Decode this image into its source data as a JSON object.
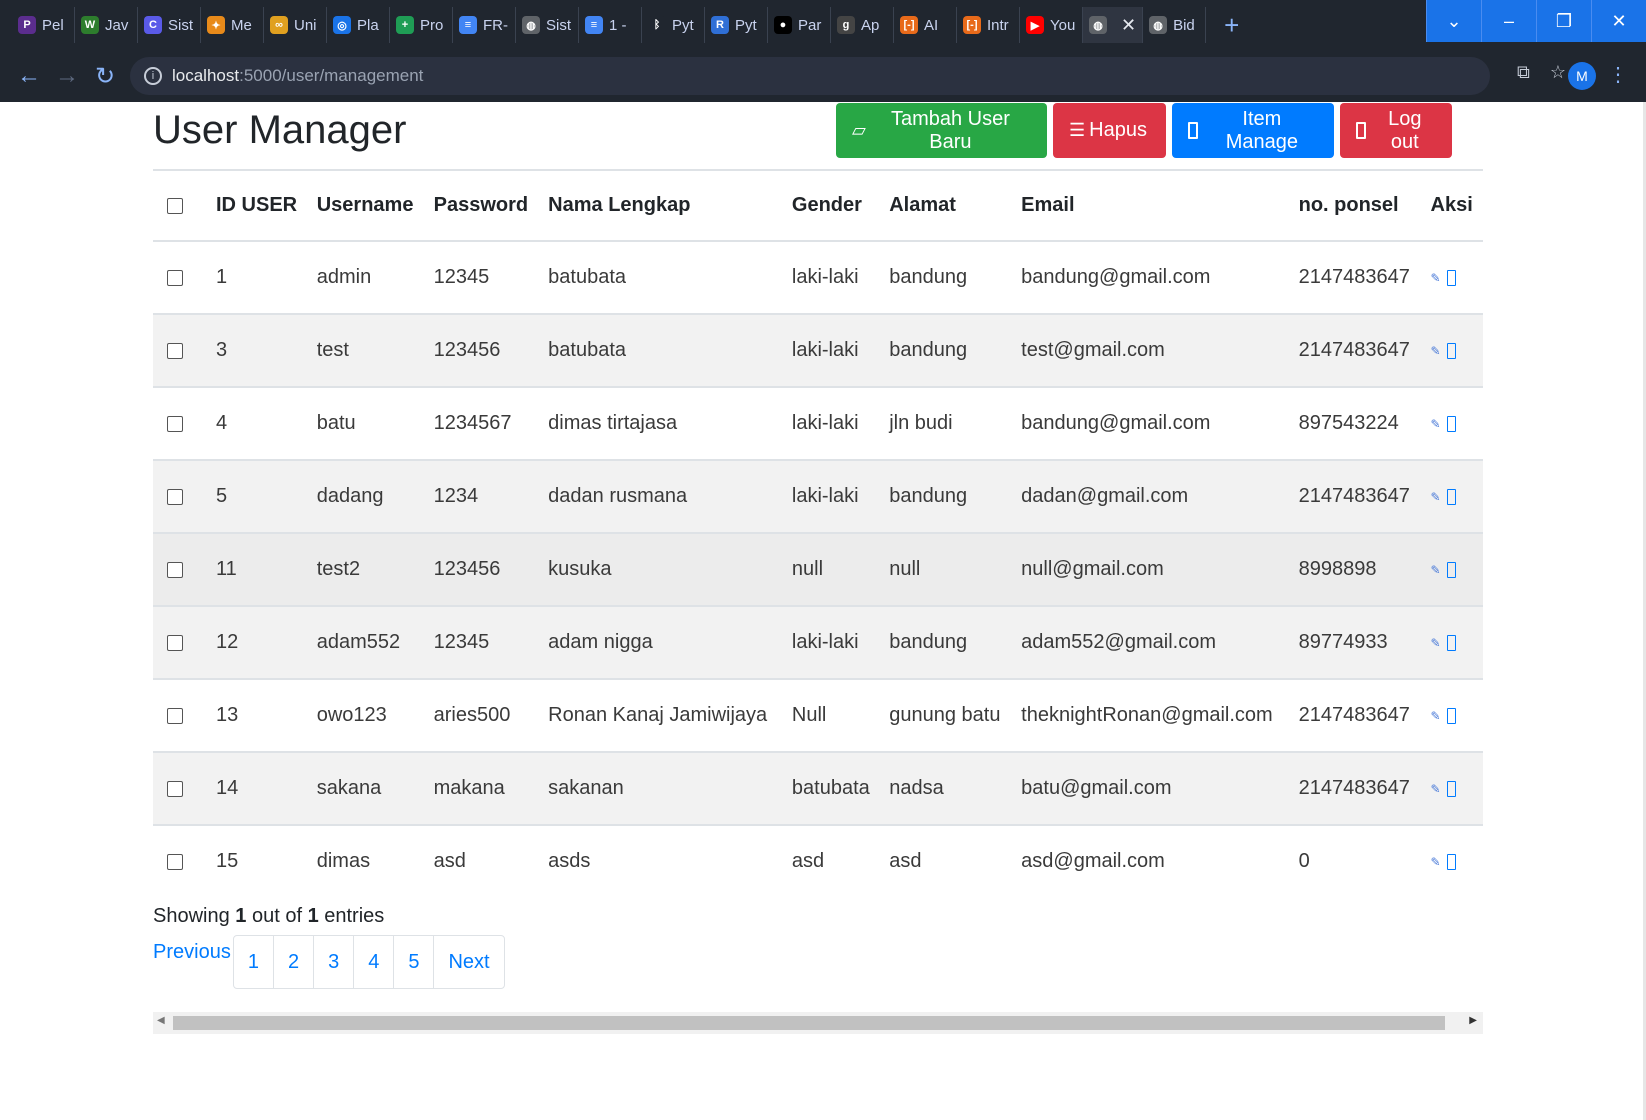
{
  "browser": {
    "tabs": [
      {
        "label": "Pel",
        "icon": "purple-p-icon",
        "color": "#5b2d8e",
        "glyph": "P"
      },
      {
        "label": "Jav",
        "icon": "w-logo-icon",
        "color": "#2d7d2d",
        "glyph": "W"
      },
      {
        "label": "Sist",
        "icon": "c-logo-icon",
        "color": "#5a5ae8",
        "glyph": "C"
      },
      {
        "label": "Me",
        "icon": "pinwheel-icon",
        "color": "#e88a1a",
        "glyph": "✦"
      },
      {
        "label": "Uni",
        "icon": "infinity-icon",
        "color": "#e0a020",
        "glyph": "∞"
      },
      {
        "label": "Pla",
        "icon": "target-icon",
        "color": "#1a73e8",
        "glyph": "◎"
      },
      {
        "label": "Pro",
        "icon": "plus-box-icon",
        "color": "#1f9d55",
        "glyph": "+"
      },
      {
        "label": "FR-",
        "icon": "doc-icon",
        "color": "#4285f4",
        "glyph": "≡"
      },
      {
        "label": "Sist",
        "icon": "globe-icon",
        "color": "#5f6368",
        "glyph": "◍"
      },
      {
        "label": "1 -",
        "icon": "doc-icon",
        "color": "#4285f4",
        "glyph": "≡"
      },
      {
        "label": "Pyt",
        "icon": "bluetooth-icon",
        "color": "#20262f",
        "glyph": "ᛒ"
      },
      {
        "label": "Pyt",
        "icon": "r-logo-icon",
        "color": "#2f6fd6",
        "glyph": "R"
      },
      {
        "label": "Par",
        "icon": "medium-icon",
        "color": "#000000",
        "glyph": "●"
      },
      {
        "label": "Ap",
        "icon": "g-logo-icon",
        "color": "#444444",
        "glyph": "g"
      },
      {
        "label": "AI",
        "icon": "bracket-icon",
        "color": "#e86a1a",
        "glyph": "[-]"
      },
      {
        "label": "Intr",
        "icon": "bracket-icon",
        "color": "#e86a1a",
        "glyph": "[-]"
      },
      {
        "label": "You",
        "icon": "youtube-icon",
        "color": "#ff0000",
        "glyph": "▶"
      },
      {
        "label": "",
        "icon": "globe-icon",
        "color": "#5f6368",
        "glyph": "◍",
        "active": true
      },
      {
        "label": "Bid",
        "icon": "globe-icon",
        "color": "#5f6368",
        "glyph": "◍"
      }
    ],
    "url_host": "localhost",
    "url_rest": ":5000/user/management",
    "profile_initial": "M"
  },
  "page": {
    "title": "User Manager",
    "buttons": {
      "add_user": "Tambah User Baru",
      "delete": "Hapus",
      "item_manage": "Item Manage",
      "logout": "Log out"
    },
    "colors": {
      "success": "#28a745",
      "danger": "#dc3545",
      "primary": "#007bff"
    }
  },
  "table": {
    "headers": {
      "id": "ID USER",
      "username": "Username",
      "password": "Password",
      "fullname": "Nama Lengkap",
      "gender": "Gender",
      "address": "Alamat",
      "email": "Email",
      "phone": "no. ponsel",
      "actions": "Aksi"
    },
    "rows": [
      {
        "id": "1",
        "username": "admin",
        "password": "12345",
        "fullname": "batubata",
        "gender": "laki-laki",
        "address": "bandung",
        "email": "bandung@gmail.com",
        "phone": "2147483647"
      },
      {
        "id": "3",
        "username": "test",
        "password": "123456",
        "fullname": "batubata",
        "gender": "laki-laki",
        "address": "bandung",
        "email": "test@gmail.com",
        "phone": "2147483647"
      },
      {
        "id": "4",
        "username": "batu",
        "password": "1234567",
        "fullname": "dimas tirtajasa",
        "gender": "laki-laki",
        "address": "jln budi",
        "email": "bandung@gmail.com",
        "phone": "897543224"
      },
      {
        "id": "5",
        "username": "dadang",
        "password": "1234",
        "fullname": "dadan rusmana",
        "gender": "laki-laki",
        "address": "bandung",
        "email": "dadan@gmail.com",
        "phone": "2147483647"
      },
      {
        "id": "11",
        "username": "test2",
        "password": "123456",
        "fullname": "kusuka",
        "gender": "null",
        "address": "null",
        "email": "null@gmail.com",
        "phone": "8998898"
      },
      {
        "id": "12",
        "username": "adam552",
        "password": "12345",
        "fullname": "adam nigga",
        "gender": "laki-laki",
        "address": "bandung",
        "email": "adam552@gmail.com",
        "phone": "89774933"
      },
      {
        "id": "13",
        "username": "owo123",
        "password": "aries500",
        "fullname": "Ronan Kanaj Jamiwijaya",
        "gender": "Null",
        "address": "gunung batu",
        "email": "theknightRonan@gmail.com",
        "phone": "2147483647"
      },
      {
        "id": "14",
        "username": "sakana",
        "password": "makana",
        "fullname": "sakanan",
        "gender": "batubata",
        "address": "nadsa",
        "email": "batu@gmail.com",
        "phone": "2147483647"
      },
      {
        "id": "15",
        "username": "dimas",
        "password": "asd",
        "fullname": "asds",
        "gender": "asd",
        "address": "asd",
        "email": "asd@gmail.com",
        "phone": "0"
      }
    ]
  },
  "footer": {
    "showing_prefix": "Showing ",
    "showing_current": "1",
    "showing_mid": " out of ",
    "showing_total": "1",
    "showing_suffix": " entries",
    "previous": "Previous",
    "pages": [
      "1",
      "2",
      "3",
      "4",
      "5"
    ],
    "next": "Next"
  }
}
